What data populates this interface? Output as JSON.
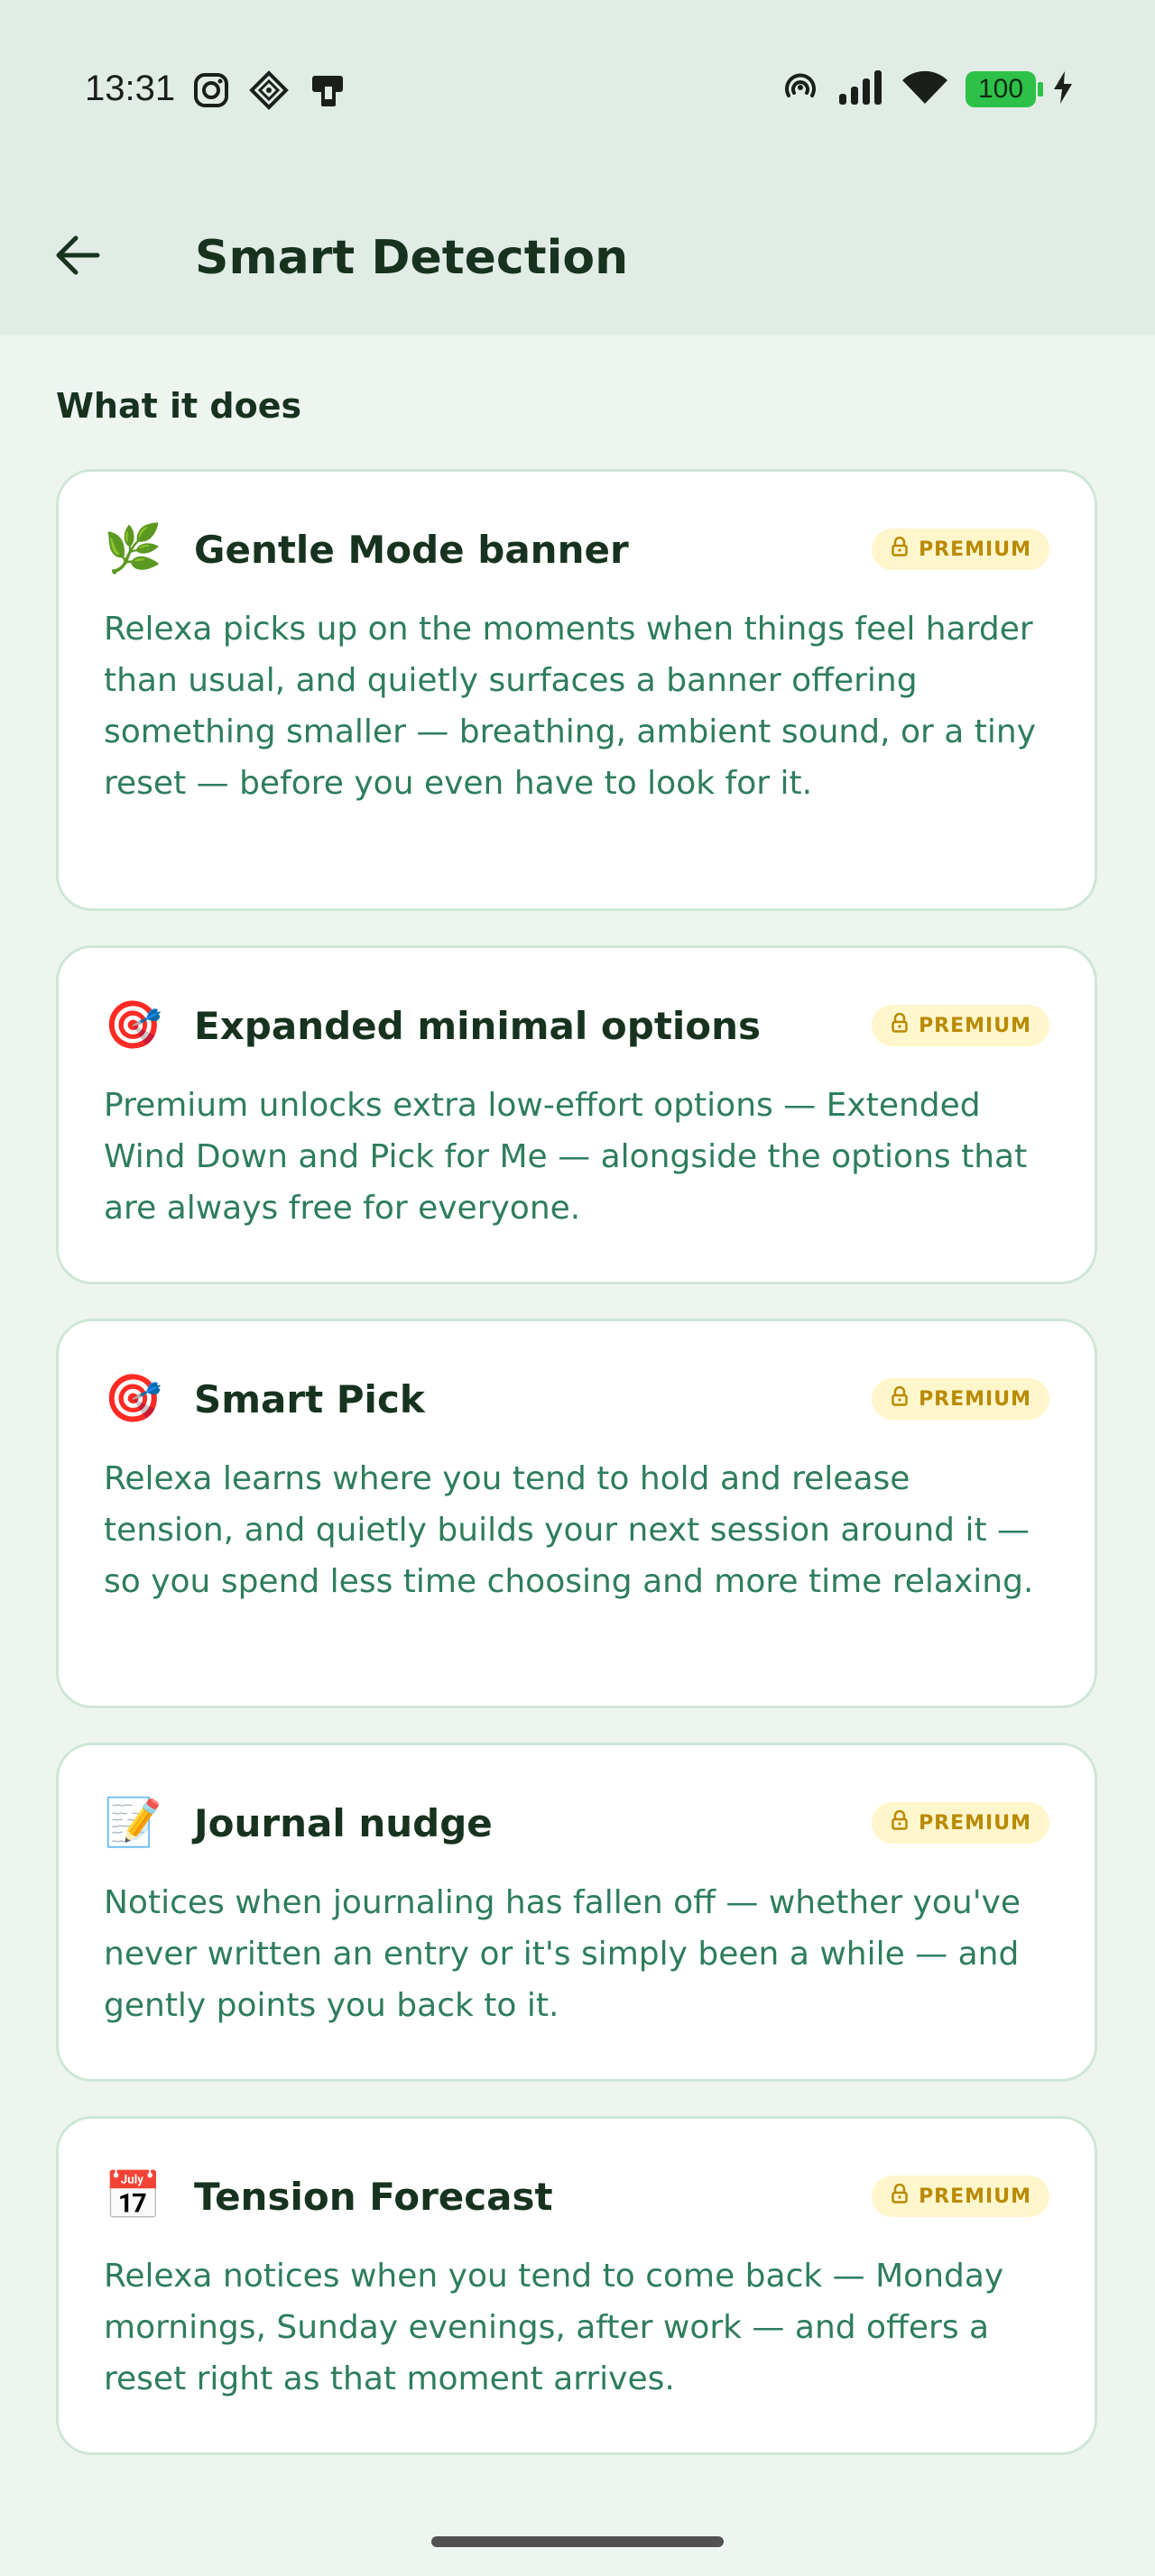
{
  "status_bar": {
    "time": "13:31",
    "battery": "100",
    "left_icons": [
      "instagram-icon",
      "diamond-app-icon",
      "device-app-icon"
    ],
    "right_icons": [
      "hotspot-icon",
      "signal-icon",
      "wifi-icon",
      "battery-icon",
      "charging-icon"
    ]
  },
  "app_bar": {
    "back_icon": "arrow-left-icon",
    "title": "Smart Detection"
  },
  "section": {
    "title": "What it does"
  },
  "badge": {
    "label": "PREMIUM",
    "icon": "lock-icon"
  },
  "cards": [
    {
      "emoji": "🌿",
      "icon": "herb-icon",
      "title": "Gentle Mode banner",
      "body": "Relexa picks up on the moments when things feel harder than usual, and quietly surfaces a banner offering something smaller — breathing, ambient sound, or a tiny reset — before you even have to look for it."
    },
    {
      "emoji": "🎯",
      "icon": "target-icon",
      "title": "Expanded minimal options",
      "body": "Premium unlocks extra low-effort options — Extended Wind Down and Pick for Me — alongside the options that are always free for everyone."
    },
    {
      "emoji": "🎯",
      "icon": "target-icon",
      "title": "Smart Pick",
      "body": "Relexa learns where you tend to hold and release tension, and quietly builds your next session around it — so you spend less time choosing and more time relaxing."
    },
    {
      "emoji": "📝",
      "icon": "memo-icon",
      "title": "Journal nudge",
      "body": "Notices when journaling has fallen off — whether you've never written an entry or it's simply been a while — and gently points you back to it."
    },
    {
      "emoji": "📅",
      "icon": "calendar-icon",
      "title": "Tension Forecast",
      "body": "Relexa notices when you tend to come back — Monday mornings, Sunday evenings, after work — and offers a reset right as that moment arrives."
    }
  ],
  "colors": {
    "background": "#eef5f1",
    "app_bar": "#e2ece6",
    "card_border": "#cfe6d7",
    "title": "#17331f",
    "body_text": "#2e7d5d",
    "badge_bg": "#fff6cc",
    "badge_text": "#b98a00",
    "battery": "#2ec14a"
  }
}
